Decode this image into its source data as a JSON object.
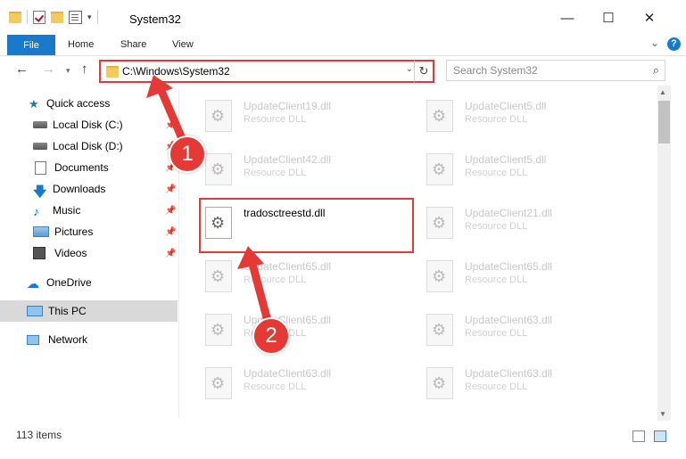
{
  "window": {
    "title": "System32",
    "controls": {
      "minimize": "—",
      "maximize": "☐",
      "close": "✕"
    }
  },
  "ribbon": {
    "tabs": [
      "File",
      "Home",
      "Share",
      "View"
    ],
    "help": "?"
  },
  "address": {
    "path": "C:\\Windows\\System32",
    "search_placeholder": "Search System32"
  },
  "navigation": {
    "quick_access": "Quick access",
    "items": [
      {
        "label": "Local Disk (C:)",
        "icon": "drive-icon"
      },
      {
        "label": "Local Disk (D:)",
        "icon": "drive-icon"
      },
      {
        "label": "Documents",
        "icon": "documents-icon"
      },
      {
        "label": "Downloads",
        "icon": "downloads-icon"
      },
      {
        "label": "Music",
        "icon": "music-icon"
      },
      {
        "label": "Pictures",
        "icon": "pictures-icon"
      },
      {
        "label": "Videos",
        "icon": "videos-icon"
      }
    ],
    "onedrive": "OneDrive",
    "this_pc": "This PC",
    "network": "Network"
  },
  "files": [
    {
      "name": "UpdateClient19.dll",
      "type": "Resource DLL"
    },
    {
      "name": "UpdateClient5.dll",
      "type": "Resource DLL"
    },
    {
      "name": "UpdateClient42.dll",
      "type": "Resource DLL"
    },
    {
      "name": "UpdateClient5.dll",
      "type": "Resource DLL"
    },
    {
      "name": "tradosctreestd.dll",
      "type": ""
    },
    {
      "name": "UpdateClient21.dll",
      "type": "Resource DLL"
    },
    {
      "name": "UpdateClient65.dll",
      "type": "Resource DLL"
    },
    {
      "name": "UpdateClient65.dll",
      "type": "Resource DLL"
    },
    {
      "name": "UpdateClient65.dll",
      "type": "Resource DLL"
    },
    {
      "name": "UpdateClient63.dll",
      "type": "Resource DLL"
    },
    {
      "name": "UpdateClient63.dll",
      "type": "Resource DLL"
    },
    {
      "name": "UpdateClient63.dll",
      "type": "Resource DLL"
    }
  ],
  "status": {
    "item_count": "113 items"
  },
  "annotations": {
    "step1": "1",
    "step2": "2"
  },
  "colors": {
    "accent": "#1979ca",
    "highlight": "#e53935"
  }
}
